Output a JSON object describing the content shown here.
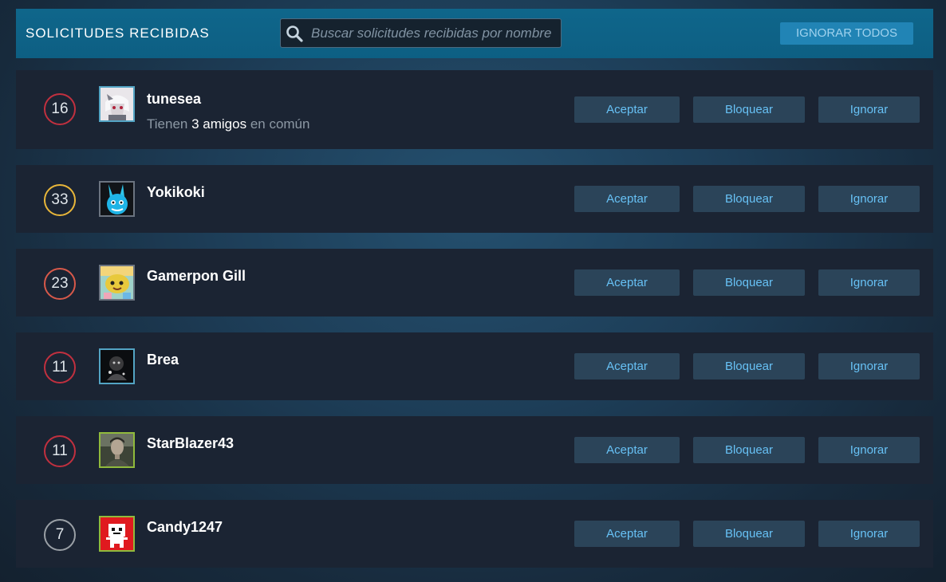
{
  "header": {
    "title": "SOLICITUDES RECIBIDAS",
    "search_placeholder": "Buscar solicitudes recibidas por nombre",
    "ignore_all_label": "IGNORAR TODOS"
  },
  "buttons": {
    "accept": "Aceptar",
    "block": "Bloquear",
    "ignore": "Ignorar"
  },
  "requests": [
    {
      "level": "16",
      "level_color": "#c1303f",
      "name": "tunesea",
      "mutual": {
        "prefix": "Tienen",
        "count": "3 amigos",
        "suffix": "en común"
      },
      "avatar_icon": "white-haired-anime-avatar",
      "avatar_border": "#53a4c4"
    },
    {
      "level": "33",
      "level_color": "#e8b63a",
      "name": "Yokikoki",
      "avatar_icon": "blue-rabbit-avatar",
      "avatar_border": "#6b7480"
    },
    {
      "level": "23",
      "level_color": "#d8594a",
      "name": "Gamerpon Gill",
      "avatar_icon": "yellow-creature-avatar",
      "avatar_border": "#6b7480"
    },
    {
      "level": "11",
      "level_color": "#c1303f",
      "name": "Brea",
      "avatar_icon": "dark-character-avatar",
      "avatar_border": "#53a4c4"
    },
    {
      "level": "11",
      "level_color": "#c1303f",
      "name": "StarBlazer43",
      "avatar_icon": "soldier-portrait-avatar",
      "avatar_border": "#90ba3c"
    },
    {
      "level": "7",
      "level_color": "#9aa0a6",
      "name": "Candy1247",
      "avatar_icon": "red-robot-avatar",
      "avatar_border": "#90ba3c"
    }
  ]
}
